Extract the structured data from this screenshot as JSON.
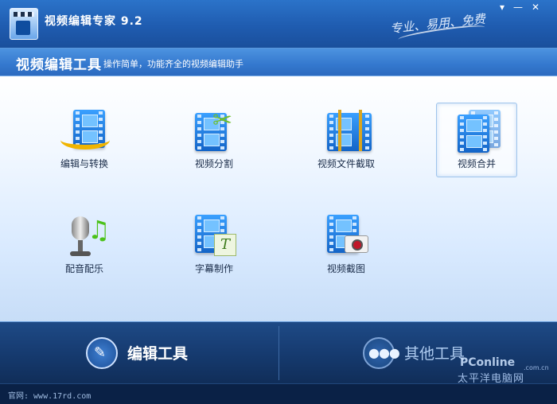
{
  "window": {
    "title": "视频编辑专家 9.2",
    "slogan": "专业、易用、免费",
    "controls": {
      "menu": "▾",
      "minimize": "—",
      "close": "✕"
    }
  },
  "header": {
    "title": "视频编辑工具",
    "subtitle": "操作简单，功能齐全的视频编辑助手"
  },
  "tools": [
    {
      "label": "编辑与转换",
      "icon": "film-convert-icon"
    },
    {
      "label": "视频分割",
      "icon": "film-scissors-icon"
    },
    {
      "label": "视频文件截取",
      "icon": "film-trim-icon"
    },
    {
      "label": "视频合并",
      "icon": "film-merge-icon",
      "selected": true
    },
    {
      "label": "配音配乐",
      "icon": "microphone-music-icon"
    },
    {
      "label": "字幕制作",
      "icon": "film-subtitle-icon"
    },
    {
      "label": "视频截图",
      "icon": "film-camera-icon"
    }
  ],
  "bottom_nav": {
    "edit_label": "编辑工具",
    "other_label": "其他工具"
  },
  "footer": {
    "website": "官网: www.17rd.com"
  },
  "watermark": {
    "brand": "PConline",
    "domain": ".com.cn",
    "cn": "太平洋电脑网"
  }
}
